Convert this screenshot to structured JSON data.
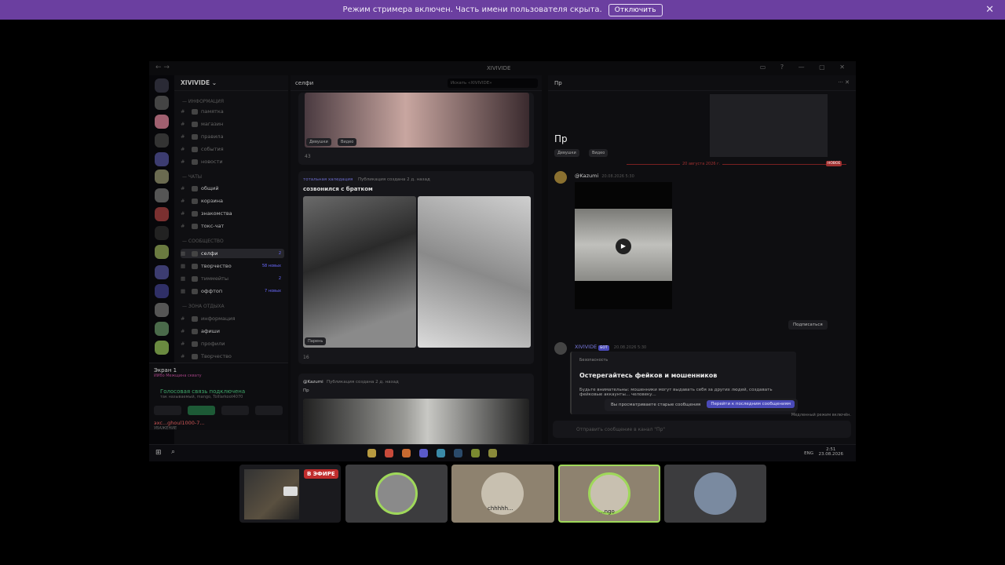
{
  "banner": {
    "text": "Режим стримера включен. Часть имени пользователя скрыта.",
    "button": "Отключить"
  },
  "window": {
    "title": "XIVIVIDE"
  },
  "server": {
    "name": "XIVIVIDE",
    "categories": [
      "— ИНФОРМАЦИЯ",
      "— ЧАТЫ",
      "— СООБЩЕСТВО",
      "— ЗОНА ОТДЫХА"
    ],
    "channels": [
      {
        "name": "памятка"
      },
      {
        "name": "магазин"
      },
      {
        "name": "правила"
      },
      {
        "name": "события"
      },
      {
        "name": "новости"
      },
      {
        "name": "общий"
      },
      {
        "name": "корзина"
      },
      {
        "name": "знакомства"
      },
      {
        "name": "токс-чат"
      },
      {
        "name": "селфи",
        "badge": "2"
      },
      {
        "name": "творчество",
        "badge": "58 новых"
      },
      {
        "name": "тиммейты",
        "badge": "2"
      },
      {
        "name": "оффтоп",
        "badge": "7 новых"
      },
      {
        "name": "информация"
      },
      {
        "name": "афиши"
      },
      {
        "name": "профили"
      },
      {
        "name": "Творчество"
      }
    ]
  },
  "voice": {
    "screen_title": "Экран 1",
    "screen_sub": "ИИбо Межщина сквату",
    "status": "Голосовая связь подключена",
    "status_sub": "так называемый, mango, Tolllarkoot4070",
    "user_name": "эхс...ghoul1000-7...",
    "user_status": "УВАЖЕНИЕ"
  },
  "feed": {
    "channel": "селфи",
    "search_placeholder": "Искать «XIVIVIDE»",
    "tag_girls": "Девушки",
    "tag_video": "Видео",
    "count1": "43",
    "post2_author": "тотальная халедация",
    "post2_meta": "Публикация создана 2 д. назад",
    "post2_title": "созвонился с братком",
    "tag_guy": "Парень",
    "count2": "16",
    "post3_author": "@Kazumi",
    "post3_meta": "Публикация создана 2 д. назад",
    "post3_title": "Пр"
  },
  "thread": {
    "header": "Пр",
    "title": "Пр",
    "tag_girls": "Девушки",
    "tag_video": "Видео",
    "date_divider": "20 августа 2026 г.",
    "new_label": "НОВОЕ",
    "msg1_author": "@Kazumi",
    "msg1_time": "20.08.2026 5:30",
    "subscribe": "Подписаться",
    "msg2_author": "XIVIVIDE",
    "msg2_bot": "БОТ",
    "msg2_time": "20.08.2026 5:30",
    "embed_label": "Безопасность",
    "embed_title": "Остерегайтесь фейков и мошенников",
    "embed_body": "Будьте внимательны: мошенники могут выдавать себя за других людей, создавать фейковые аккаунты... человеку...",
    "old_msgs": "Вы просматриваете старые сообщения",
    "jump_latest": "Перейти к последним сообщениям",
    "slow_mode": "Медленный режим включён.",
    "composer_placeholder": "Отправить сообщение в канал \"Пр\""
  },
  "taskbar": {
    "lang": "ENG",
    "time": "2:51",
    "date": "23.08.2026"
  },
  "tiles": {
    "live_label": "В ЭФИРЕ",
    "tile3_name": "chhhhh...",
    "tile4_name": "...ngo"
  },
  "colors": {
    "banner": "#6b3fa0",
    "live": "#c02d2d",
    "speaking_ring": "#9fd85a",
    "accent": "#4a4ab8"
  }
}
